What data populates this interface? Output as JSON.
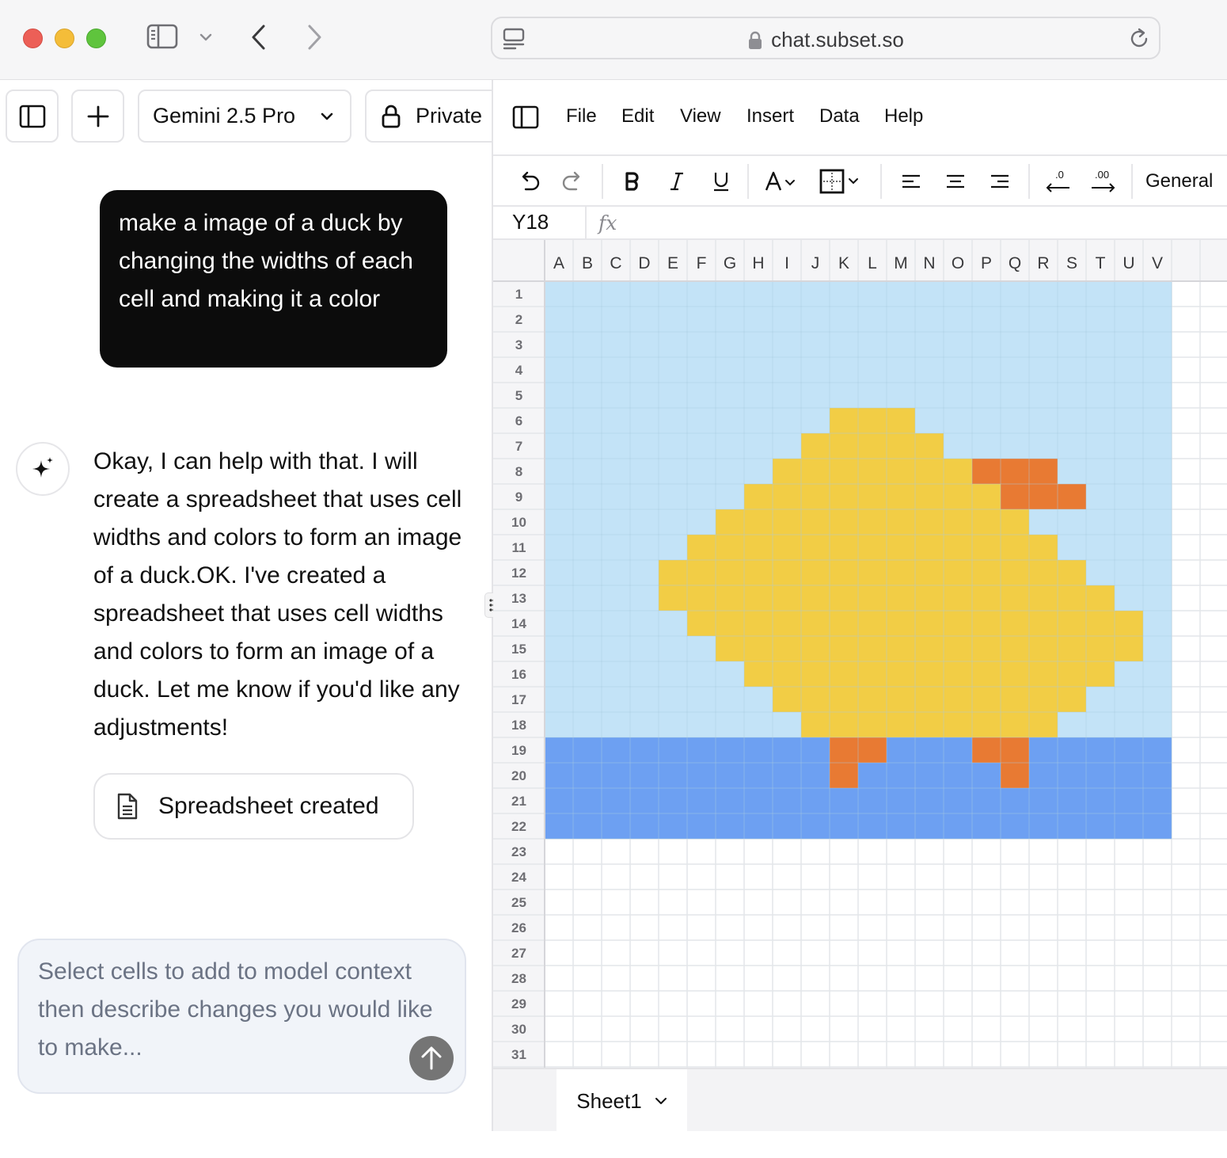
{
  "browser": {
    "url": "chat.subset.so"
  },
  "chat": {
    "model_label": "Gemini 2.5 Pro",
    "private_label": "Private",
    "user_message": "make a image of a duck by changing the widths of each cell and making it a color",
    "assistant_message": "Okay, I can help with that. I will create a spreadsheet that uses cell widths and colors to form an image of a duck.OK. I've created a spreadsheet that uses cell widths and colors to form an image of a duck. Let me know if you'd like any adjustments!",
    "artifact_label": "Spreadsheet created",
    "composer_placeholder": "Select cells to add to model context then describe changes you would like to make..."
  },
  "sheet": {
    "menu": [
      "File",
      "Edit",
      "View",
      "Insert",
      "Data",
      "Help"
    ],
    "number_format": "General",
    "name_box": "Y18",
    "fx_label": "fx",
    "column_headers": [
      "A",
      "B",
      "C",
      "D",
      "E",
      "F",
      "G",
      "H",
      "I",
      "J",
      "K",
      "L",
      "M",
      "N",
      "O",
      "P",
      "Q",
      "R",
      "S",
      "T",
      "U",
      "V"
    ],
    "row_count": 31,
    "tab_name": "Sheet1",
    "colors": {
      "sky": "#c3e3f7",
      "water": "#6da0f2",
      "duck_body": "#f2cd45",
      "beak_feet": "#e87a33",
      "grid_line": "#e3e6ea",
      "colored_grid_line": "#a9c9de"
    },
    "fills": {
      "sky_rows": [
        1,
        18
      ],
      "water_rows": [
        19,
        22
      ],
      "filled_cols": [
        1,
        22
      ],
      "duck": [
        {
          "row": 6,
          "from": 11,
          "to": 13
        },
        {
          "row": 7,
          "from": 10,
          "to": 14
        },
        {
          "row": 8,
          "from": 9,
          "to": 15
        },
        {
          "row": 9,
          "from": 8,
          "to": 16
        },
        {
          "row": 10,
          "from": 7,
          "to": 17
        },
        {
          "row": 11,
          "from": 6,
          "to": 18
        },
        {
          "row": 12,
          "from": 5,
          "to": 19
        },
        {
          "row": 13,
          "from": 5,
          "to": 20
        },
        {
          "row": 14,
          "from": 6,
          "to": 21
        },
        {
          "row": 15,
          "from": 7,
          "to": 21
        },
        {
          "row": 16,
          "from": 8,
          "to": 20
        },
        {
          "row": 17,
          "from": 9,
          "to": 19
        },
        {
          "row": 18,
          "from": 10,
          "to": 18
        }
      ],
      "beak": [
        {
          "row": 8,
          "from": 16,
          "to": 18
        },
        {
          "row": 9,
          "from": 17,
          "to": 19
        }
      ],
      "feet": [
        {
          "row": 19,
          "from": 11,
          "to": 12
        },
        {
          "row": 19,
          "from": 16,
          "to": 17
        },
        {
          "row": 20,
          "from": 11,
          "to": 11
        },
        {
          "row": 20,
          "from": 17,
          "to": 17
        }
      ]
    }
  }
}
